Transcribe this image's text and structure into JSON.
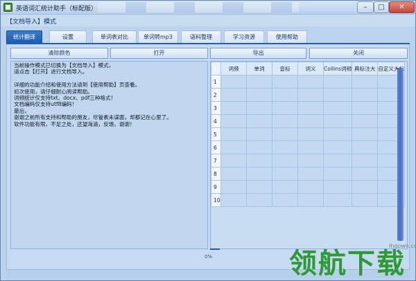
{
  "window": {
    "title": "英语词汇统计助手（标配版）",
    "min_symbol": "–",
    "max_symbol": "□",
    "close_symbol": "✕"
  },
  "mode_label": "【文档导入】模式",
  "tabs": [
    "统计翻译",
    "设置",
    "单词表对比",
    "单词转mp3",
    "语料整理",
    "学习资源",
    "使用帮助"
  ],
  "buttons": {
    "clear_color": "清除颜色",
    "open": "打开",
    "export": "导出",
    "close": "关闭"
  },
  "textarea_lines": [
    "当前操作模式已切换为【文档导入】模式，",
    "请点击【打开】进行文档导入。",
    "",
    "详细的功能介绍和使用方法请到【使用帮助】页查看。",
    "初次使用，请仔细耐心阅读帮助。",
    "词频统计仅支持txt、docx、pdf三种格式！",
    "文档编码仅支持utf8编码！",
    "最后，",
    "谢谢之前所有支持和帮助的朋友，尽管素未谋面，却都记在心里了。",
    "软件功能有限，不足之处，还望海涵，反馈。谢谢！"
  ],
  "table": {
    "columns": [
      "词频",
      "单词",
      "音标",
      "词义",
      "Collins词频",
      "典标注大",
      "自定义大标"
    ],
    "rows": [
      "1",
      "2",
      "3",
      "4",
      "5",
      "6",
      "7",
      "8",
      "9",
      "10"
    ]
  },
  "progress_text": "0%",
  "watermark": {
    "site": "lhdown.com",
    "text": "领航下载"
  }
}
